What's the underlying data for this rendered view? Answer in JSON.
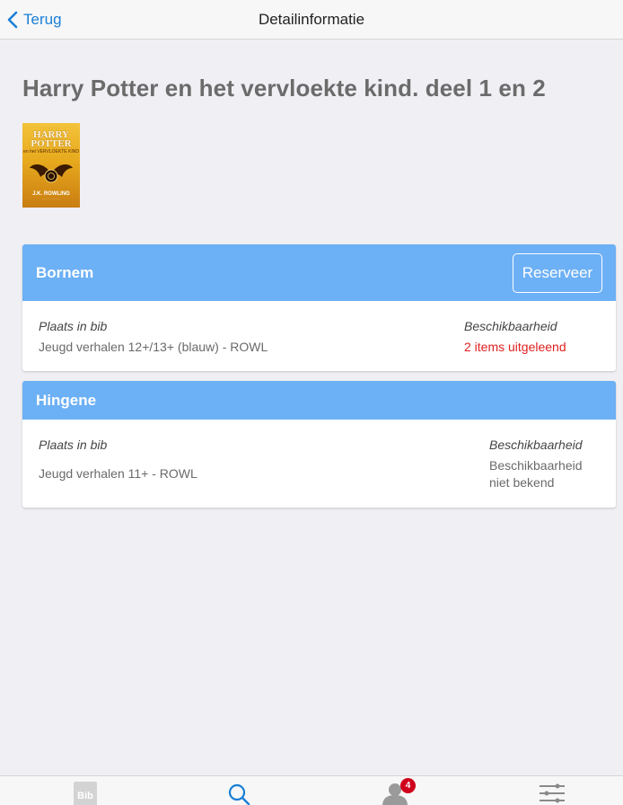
{
  "navbar": {
    "back_label": "Terug",
    "title": "Detailinformatie"
  },
  "book": {
    "title": "Harry Potter en het vervloekte kind. deel 1 en 2",
    "cover": {
      "title": "HARRY POTTER",
      "subtitle": "en het VERVLOEKTE KIND",
      "author": "J.K. ROWLING"
    }
  },
  "branches": [
    {
      "name": "Bornem",
      "reserve_label": "Reserveer",
      "location_label": "Plaats in bib",
      "location": "Jeugd verhalen 12+/13+ (blauw) - ROWL",
      "availability_label": "Beschikbaarheid",
      "availability": "2 items uitgeleend"
    },
    {
      "name": "Hingene",
      "location_label": "Plaats in bib",
      "location": "Jeugd verhalen 11+ - ROWL",
      "availability_label": "Beschikbaarheid",
      "availability_line1": "Beschikbaarheid",
      "availability_line2": "niet bekend"
    }
  ],
  "tabbar": {
    "tabs": [
      {
        "icon": "bib-logo-icon",
        "label": "Bib"
      },
      {
        "icon": "search-icon"
      },
      {
        "icon": "user-icon",
        "badge": "4"
      },
      {
        "icon": "settings-sliders-icon"
      }
    ]
  },
  "colors": {
    "accent": "#1a7fd6",
    "branch_header": "#6cb0f5",
    "alert": "#e02020",
    "background": "#efeff4"
  }
}
